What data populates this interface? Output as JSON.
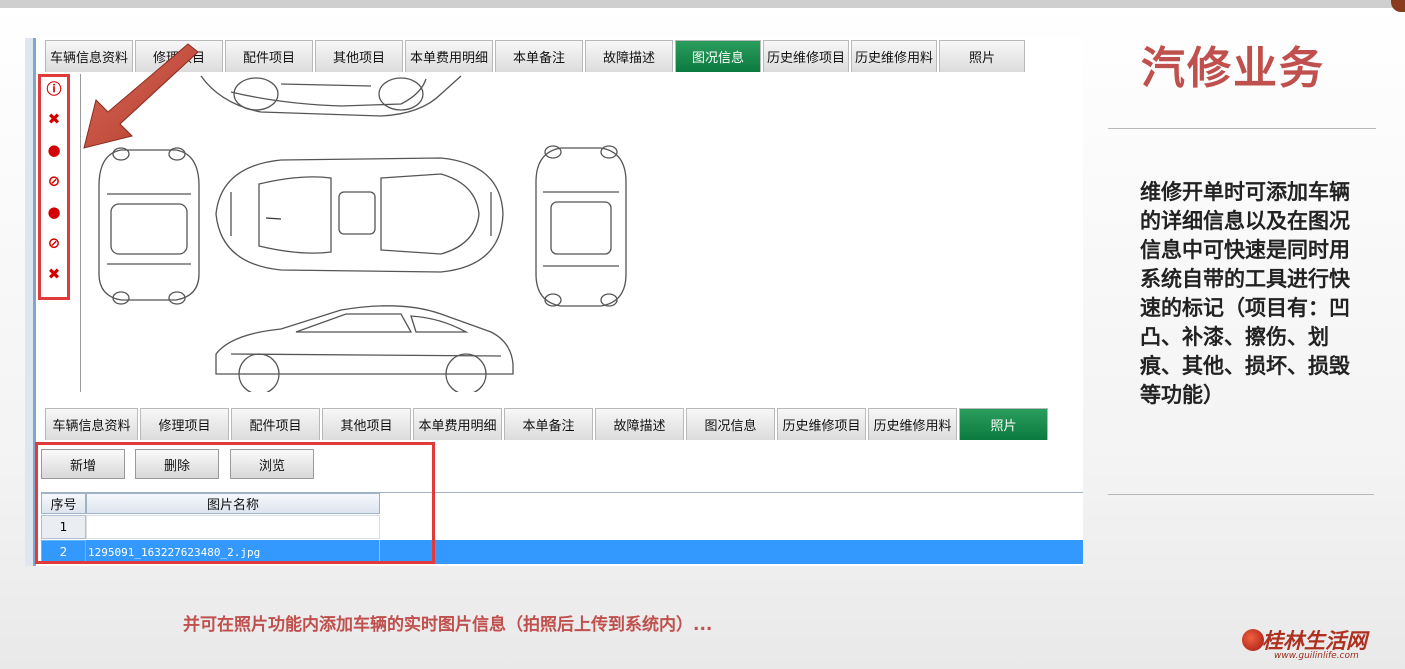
{
  "top_tabs": [
    {
      "label": "车辆信息资料"
    },
    {
      "label": "修理项目"
    },
    {
      "label": "配件项目"
    },
    {
      "label": "其他项目"
    },
    {
      "label": "本单费用明细"
    },
    {
      "label": "本单备注"
    },
    {
      "label": "故障描述"
    },
    {
      "label": "图况信息",
      "active": true
    },
    {
      "label": "历史维修项目"
    },
    {
      "label": "历史维修用料"
    },
    {
      "label": "照片"
    }
  ],
  "bottom_tabs": [
    {
      "label": "车辆信息资料"
    },
    {
      "label": "修理项目"
    },
    {
      "label": "配件项目"
    },
    {
      "label": "其他项目"
    },
    {
      "label": "本单费用明细"
    },
    {
      "label": "本单备注"
    },
    {
      "label": "故障描述"
    },
    {
      "label": "图况信息"
    },
    {
      "label": "历史维修项目"
    },
    {
      "label": "历史维修用料"
    },
    {
      "label": "照片",
      "active": true
    }
  ],
  "mark_tools": [
    "info-icon",
    "tools-icon",
    "dot-icon",
    "no-icon",
    "dot-icon",
    "no-icon",
    "tools-icon"
  ],
  "photo_toolbar": {
    "add": "新增",
    "delete": "删除",
    "browse": "浏览"
  },
  "photo_table": {
    "columns": [
      "序号",
      "图片名称"
    ],
    "rows": [
      {
        "no": "1",
        "name": ""
      },
      {
        "no": "2",
        "name": "1295091_163227623480_2.jpg",
        "selected": true
      }
    ]
  },
  "slide": {
    "title": "汽修业务",
    "description": "维修开单时可添加车辆的详细信息以及在图况信息中可快速是同时用系统自带的工具进行快速的标记（项目有：凹凸、补漆、擦伤、划痕、其他、损坏、损毁等功能）",
    "footer": "并可在照片功能内添加车辆的实时图片信息（拍照后上传到系统内）...",
    "logo": "桂林生活网",
    "logo_url": "www.guilinlife.com"
  },
  "colors": {
    "accent": "#c0504d",
    "tab_active": "#0c7a3f",
    "selection": "#3399ff",
    "highlight_box": "#e03a3a"
  }
}
